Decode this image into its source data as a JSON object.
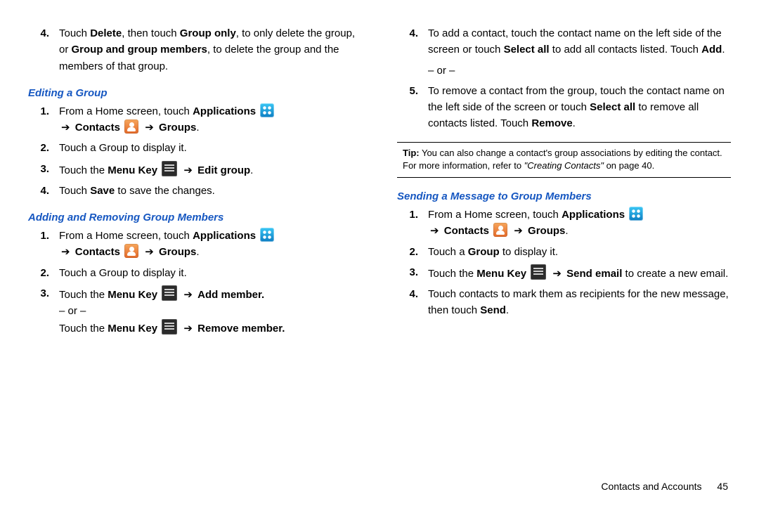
{
  "left": {
    "itemA": {
      "num": "4.",
      "t1": "Touch ",
      "b1": "Delete",
      "t2": ", then touch ",
      "b2": "Group only",
      "t3": ", to only delete the group, or ",
      "b3": "Group and group members",
      "t4": ", to delete the group and the members of that group."
    },
    "head1": "Editing a Group",
    "e1": {
      "num": "1.",
      "t1": "From a Home screen, touch ",
      "b1": "Applications"
    },
    "e1b": {
      "arrow1": "➔",
      "b1": "Contacts",
      "arrow2": "➔",
      "b2": "Groups",
      "t_end": "."
    },
    "e2": {
      "num": "2.",
      "t": "Touch a Group to display it."
    },
    "e3": {
      "num": "3.",
      "t1": "Touch the ",
      "b1": "Menu Key",
      "arrow": "➔",
      "b2": "Edit group",
      "t_end": "."
    },
    "e4": {
      "num": "4.",
      "t1": "Touch ",
      "b1": "Save",
      "t2": " to save the changes."
    },
    "head2": "Adding and Removing Group Members",
    "a1": {
      "num": "1.",
      "t1": "From a Home screen, touch ",
      "b1": "Applications"
    },
    "a1b": {
      "arrow1": "➔",
      "b1": "Contacts",
      "arrow2": "➔",
      "b2": "Groups",
      "t_end": "."
    },
    "a2": {
      "num": "2.",
      "t": "Touch a Group to display it."
    },
    "a3": {
      "num": "3.",
      "t1": "Touch the ",
      "b1": "Menu Key",
      "arrow": "➔",
      "b2": "Add member."
    },
    "a3or": "– or –",
    "a3b": {
      "t1": "Touch the ",
      "b1": "Menu Key",
      "arrow": "➔",
      "b2": "Remove member."
    }
  },
  "right": {
    "itemA": {
      "num": "4.",
      "t1": "To add a contact, touch the contact name on the left side of the screen or touch ",
      "b1": "Select all",
      "t2": " to add all contacts listed. Touch ",
      "b2": "Add",
      "t3": "."
    },
    "or": "– or –",
    "itemB": {
      "num": "5.",
      "t1": "To remove a contact from the group, touch the contact name on the left side of the screen or touch ",
      "b1": "Select all",
      "t2": " to remove all contacts listed. Touch ",
      "b2": "Remove",
      "t3": "."
    },
    "tip": {
      "label": "Tip:",
      "t1": " You can also change a contact's group associations by editing the contact. For more information, refer to ",
      "ref": "\"Creating Contacts\"",
      "t2": "  on page 40."
    },
    "head1": "Sending a Message to Group Members",
    "s1": {
      "num": "1.",
      "t1": "From a Home screen, touch ",
      "b1": "Applications"
    },
    "s1b": {
      "arrow1": "➔",
      "b1": "Contacts",
      "arrow2": "➔",
      "b2": "Groups",
      "t_end": "."
    },
    "s2": {
      "num": "2.",
      "t1": "Touch a ",
      "b1": "Group",
      "t2": " to display it."
    },
    "s3": {
      "num": "3.",
      "t1": "Touch the ",
      "b1": "Menu Key",
      "arrow": "➔",
      "b2": "Send email",
      "t2": " to create a new email."
    },
    "s4": {
      "num": "4.",
      "t1": "Touch contacts to mark them as recipients for the new message, then touch ",
      "b1": "Send",
      "t2": "."
    }
  },
  "footer": {
    "section": "Contacts and Accounts",
    "page": "45"
  }
}
